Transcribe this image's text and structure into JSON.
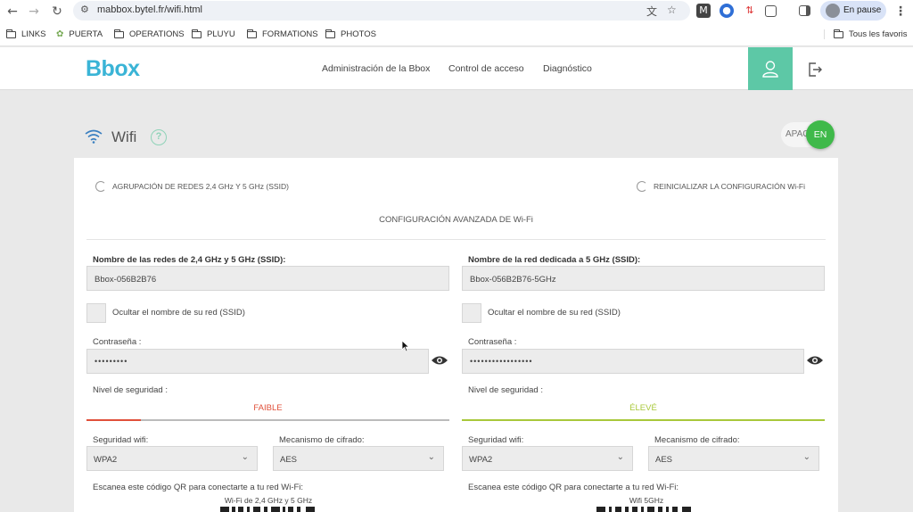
{
  "browser": {
    "url": "mabbox.bytel.fr/wifi.html",
    "profile_label": "En pause",
    "bookmarks": [
      "LINKS",
      "PUERTA",
      "OPERATIONS",
      "PLUYU",
      "FORMATIONS",
      "PHOTOS"
    ],
    "all_bookmarks": "Tous les favoris"
  },
  "header": {
    "logo": "Bbox",
    "menu": [
      "Administración de la Bbox",
      "Control de acceso",
      "Diagnóstico"
    ]
  },
  "page": {
    "title": "Wifi",
    "help": "?",
    "toggle_off": "APAG",
    "toggle_on": "EN"
  },
  "panel": {
    "grouping": "AGRUPACIÓN DE REDES 2,4 GHz Y 5 GHz (SSID)",
    "reset": "REINICIALIZAR LA CONFIGURACIÓN Wi-Fi",
    "advanced": "CONFIGURACIÓN AVANZADA DE Wi-Fi",
    "left": {
      "ssid_label": "Nombre de las redes de 2,4 GHz y 5 GHz (SSID):",
      "ssid_value": "Bbox-056B2B76",
      "hide_label": "Ocultar el nombre de su red (SSID)",
      "password_label": "Contraseña :",
      "password_value": "•••••••••",
      "security_label": "Nivel de seguridad :",
      "security_level": "FAIBLE",
      "security_fraction": 0.15,
      "wifi_sec_label": "Seguridad wifi:",
      "wifi_sec_value": "WPA2",
      "cipher_label": "Mecanismo de cifrado:",
      "cipher_value": "AES",
      "qr_label": "Escanea este código QR para conectarte a tu red Wi-Fi:",
      "qr_caption": "Wi-Fi de 2,4 GHz y 5 GHz"
    },
    "right": {
      "ssid_label": "Nombre de la red dedicada a 5 GHz (SSID):",
      "ssid_value": "Bbox-056B2B76-5GHz",
      "hide_label": "Ocultar el nombre de su red (SSID)",
      "password_label": "Contraseña :",
      "password_value": "•••••••••••••••••",
      "security_label": "Nivel de seguridad :",
      "security_level": "ÉLEVÉ",
      "security_fraction": 1.0,
      "wifi_sec_label": "Seguridad wifi:",
      "wifi_sec_value": "WPA2",
      "cipher_label": "Mecanismo de cifrado:",
      "cipher_value": "AES",
      "qr_label": "Escanea este código QR para conectarte a tu red Wi-Fi:",
      "qr_caption": "Wifi 5GHz"
    }
  },
  "colors": {
    "brand": "#3ab4d6",
    "accent": "#5dc8a6",
    "toggle_on": "#3fb94a",
    "weak": "#e0503a",
    "strong": "#a8c83a"
  }
}
